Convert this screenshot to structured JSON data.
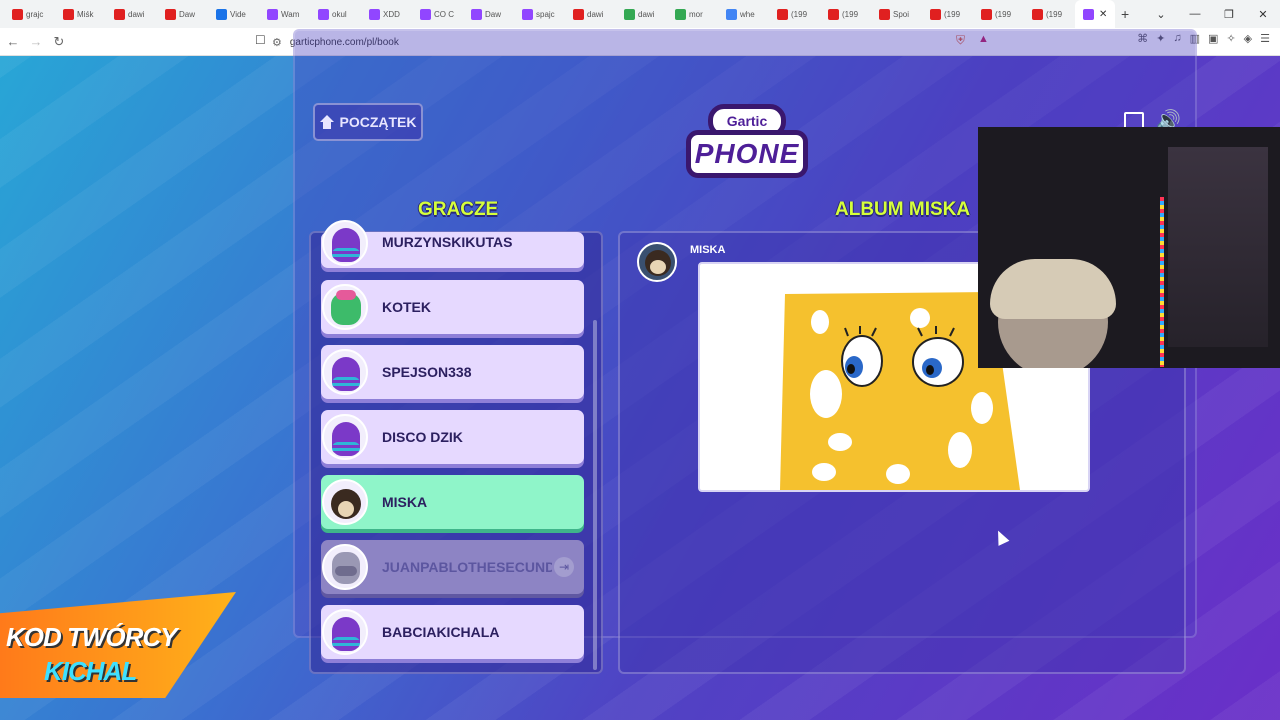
{
  "browser": {
    "tabs": [
      {
        "label": "grajc",
        "color": "#e02020"
      },
      {
        "label": "Miśk",
        "color": "#e02020"
      },
      {
        "label": "dawi",
        "color": "#e02020"
      },
      {
        "label": "Daw",
        "color": "#e02020"
      },
      {
        "label": "Vide",
        "color": "#1a73e8"
      },
      {
        "label": "Wam",
        "color": "#9146ff"
      },
      {
        "label": "okul",
        "color": "#9146ff"
      },
      {
        "label": "XDD",
        "color": "#9146ff"
      },
      {
        "label": "CO C",
        "color": "#9146ff"
      },
      {
        "label": "Daw",
        "color": "#9146ff"
      },
      {
        "label": "spajc",
        "color": "#9146ff"
      },
      {
        "label": "dawi",
        "color": "#e02020"
      },
      {
        "label": "dawi",
        "color": "#34a853"
      },
      {
        "label": "mor",
        "color": "#34a853"
      },
      {
        "label": "whe",
        "color": "#4285f4"
      },
      {
        "label": "(199",
        "color": "#e02020"
      },
      {
        "label": "(199",
        "color": "#e02020"
      },
      {
        "label": "Spoi",
        "color": "#e02020"
      },
      {
        "label": "(199",
        "color": "#e02020"
      },
      {
        "label": "(199",
        "color": "#e02020"
      },
      {
        "label": "(199",
        "color": "#e02020"
      }
    ],
    "active_tab": {
      "label": "G",
      "color": "#9146ff"
    },
    "url": "garticphone.com/pl/book"
  },
  "game": {
    "home_label": "POCZĄTEK",
    "logo_top": "Gartic",
    "logo_bottom": "PHONE",
    "players_heading": "GRACZE",
    "album_heading": "ALBUM MISKA",
    "players": [
      {
        "name": "MURZYNSKIKUTAS",
        "avatar": "purple",
        "state": "normal"
      },
      {
        "name": "KOTEK",
        "avatar": "green",
        "state": "normal"
      },
      {
        "name": "SPEJSON338",
        "avatar": "purple",
        "state": "normal"
      },
      {
        "name": "DISCO DZIK",
        "avatar": "purple",
        "state": "normal"
      },
      {
        "name": "MISKA",
        "avatar": "dog",
        "state": "active"
      },
      {
        "name": "JUANPABLOTHESECUNDO",
        "avatar": "grey",
        "state": "disconnected"
      },
      {
        "name": "BABCIAKICHALA",
        "avatar": "purple",
        "state": "normal"
      }
    ],
    "album_author": "MISKA"
  },
  "promo": {
    "line1": "KOD TWÓRCY",
    "line2": "KICHAL"
  }
}
